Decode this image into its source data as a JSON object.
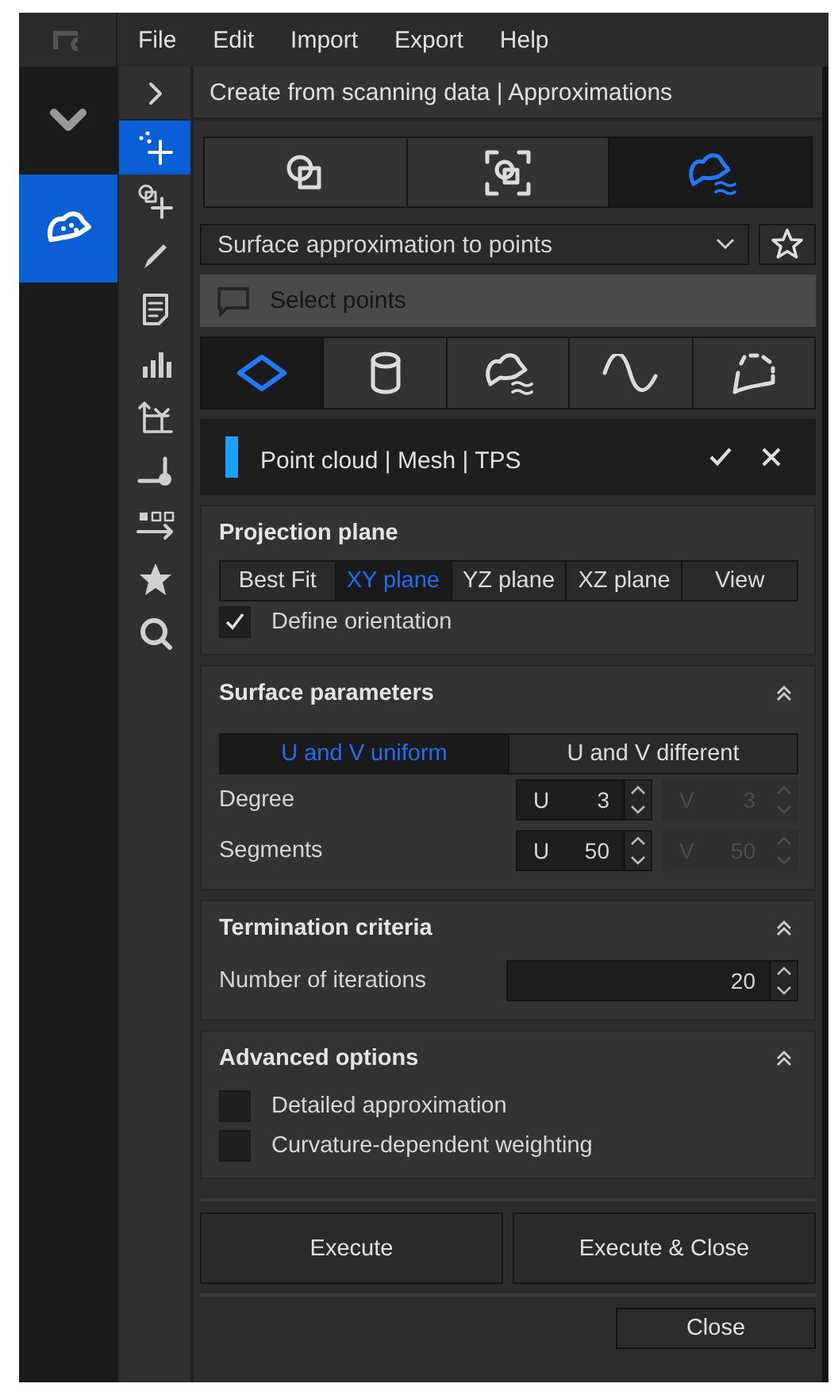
{
  "menu": [
    "File",
    "Edit",
    "Import",
    "Export",
    "Help"
  ],
  "side_nav": [
    {
      "kind": "chevron",
      "selected": false
    },
    {
      "kind": "shape",
      "selected": true
    }
  ],
  "toolbar": [
    {
      "kind": "expand",
      "selected": false
    },
    {
      "kind": "points-add",
      "selected": true
    },
    {
      "kind": "squares-add",
      "selected": false
    },
    {
      "kind": "pencil",
      "selected": false
    },
    {
      "kind": "document",
      "selected": false
    },
    {
      "kind": "bars",
      "selected": false
    },
    {
      "kind": "axes",
      "selected": false
    },
    {
      "kind": "pin",
      "selected": false
    },
    {
      "kind": "arrow",
      "selected": false
    },
    {
      "kind": "star",
      "selected": false
    },
    {
      "kind": "search",
      "selected": false
    }
  ],
  "panel": {
    "title": "Create from scanning data | Approximations",
    "mode_tabs": [
      {
        "kind": "overlap",
        "selected": false
      },
      {
        "kind": "overlap-frame",
        "selected": false
      },
      {
        "kind": "freeform",
        "selected": true
      }
    ],
    "function_dropdown": {
      "value": "Surface approximation to points"
    },
    "prompt": {
      "placeholder": "Select points"
    },
    "type_tabs": [
      {
        "kind": "plane",
        "selected": true
      },
      {
        "kind": "cylinder",
        "selected": false
      },
      {
        "kind": "freeform",
        "selected": false
      },
      {
        "kind": "wave",
        "selected": false
      },
      {
        "kind": "dotted-curve",
        "selected": false
      }
    ],
    "element": {
      "label": "Point cloud | Mesh | TPS",
      "color": "#1ea0ff"
    },
    "projection_plane": {
      "title": "Projection plane",
      "options": [
        {
          "label": "Best Fit",
          "selected": false
        },
        {
          "label": "XY plane",
          "selected": true
        },
        {
          "label": "YZ plane",
          "selected": false
        },
        {
          "label": "XZ plane",
          "selected": false
        },
        {
          "label": "View",
          "selected": false
        }
      ],
      "checkbox": {
        "label": "Define orientation",
        "checked": true
      }
    },
    "surface_parameters": {
      "title": "Surface parameters",
      "expanded": true,
      "options": [
        {
          "label": "U and V uniform",
          "selected": true
        },
        {
          "label": "U and V different",
          "selected": false
        }
      ],
      "rows": [
        {
          "label": "Degree",
          "fields": [
            {
              "prefix": "U",
              "value": "3",
              "disabled": false
            },
            {
              "prefix": "V",
              "value": "3",
              "disabled": true
            }
          ]
        },
        {
          "label": "Segments",
          "fields": [
            {
              "prefix": "U",
              "value": "50",
              "disabled": false
            },
            {
              "prefix": "V",
              "value": "50",
              "disabled": true
            }
          ]
        }
      ]
    },
    "termination_criteria": {
      "title": "Termination criteria",
      "expanded": true,
      "rows": [
        {
          "label": "Number of iterations",
          "value": "20"
        }
      ]
    },
    "advanced_options": {
      "title": "Advanced options",
      "expanded": true,
      "checkboxes": [
        {
          "label": "Detailed approximation",
          "checked": false
        },
        {
          "label": "Curvature-dependent weighting",
          "checked": false
        }
      ]
    },
    "buttons": [
      "Execute",
      "Execute & Close"
    ],
    "close_button": "Close"
  }
}
